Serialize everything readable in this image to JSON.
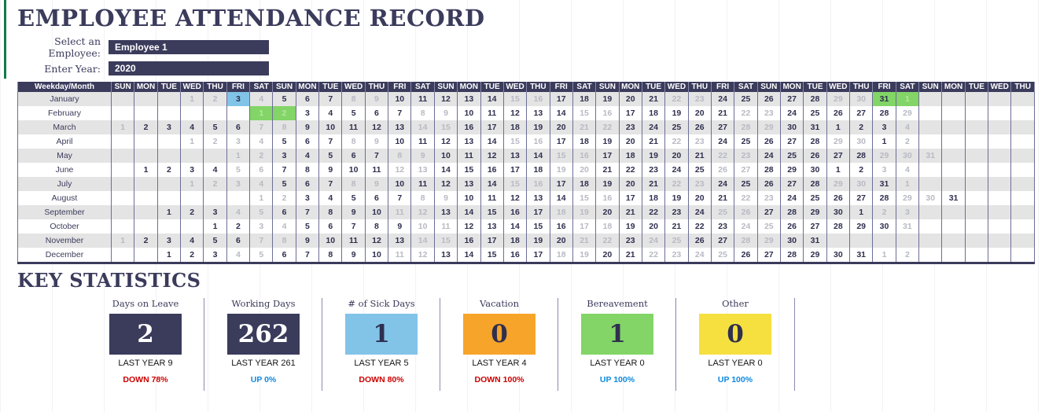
{
  "header": {
    "title": "EMPLOYEE ATTENDANCE RECORD",
    "employee_label": "Select an Employee:",
    "employee_value": "Employee 1",
    "year_label": "Enter Year:",
    "year_value": "2020"
  },
  "calendar": {
    "corner_header": "Weekday/Month",
    "weekday_cycle": [
      "SUN",
      "MON",
      "TUE",
      "WED",
      "THU",
      "FRI",
      "SAT"
    ],
    "column_count": 40,
    "columns": [
      "SUN",
      "MON",
      "TUE",
      "WED",
      "THU",
      "FRI",
      "SAT",
      "SUN",
      "MON",
      "TUE",
      "WED",
      "THU",
      "FRI",
      "SAT",
      "SUN",
      "MON",
      "TUE",
      "WED",
      "THU",
      "FRI",
      "SAT",
      "SUN",
      "MON",
      "TUE",
      "WED",
      "THU",
      "FRI",
      "SAT",
      "SUN",
      "MON",
      "TUE",
      "WED",
      "THU",
      "FRI",
      "SAT",
      "SUN",
      "MON",
      "TUE",
      "WED",
      "THU"
    ],
    "rows": [
      {
        "month": "January",
        "cells": [
          "",
          "",
          "",
          1,
          2,
          3,
          4,
          5,
          6,
          7,
          8,
          9,
          10,
          11,
          12,
          13,
          14,
          15,
          16,
          17,
          18,
          19,
          20,
          21,
          22,
          23,
          24,
          25,
          26,
          27,
          28,
          29,
          30,
          31,
          1,
          "",
          "",
          "",
          "",
          ""
        ],
        "weekend_idx": [
          3,
          4,
          5,
          6,
          10,
          11,
          17,
          18,
          24,
          25,
          31,
          32,
          34
        ],
        "sick_idx": [
          5
        ],
        "leave_idx": [
          33,
          34
        ]
      },
      {
        "month": "February",
        "cells": [
          "",
          "",
          "",
          "",
          "",
          "",
          1,
          2,
          3,
          4,
          5,
          6,
          7,
          8,
          9,
          10,
          11,
          12,
          13,
          14,
          15,
          16,
          17,
          18,
          19,
          20,
          21,
          22,
          23,
          24,
          25,
          26,
          27,
          28,
          29,
          "",
          "",
          "",
          "",
          ""
        ],
        "weekend_idx": [
          6,
          7,
          13,
          14,
          20,
          21,
          27,
          28,
          34
        ],
        "sick_idx": [],
        "leave_idx": [
          6,
          7
        ]
      },
      {
        "month": "March",
        "cells": [
          1,
          2,
          3,
          4,
          5,
          6,
          7,
          8,
          9,
          10,
          11,
          12,
          13,
          14,
          15,
          16,
          17,
          18,
          19,
          20,
          21,
          22,
          23,
          24,
          25,
          26,
          27,
          28,
          29,
          30,
          31,
          1,
          2,
          3,
          4,
          "",
          "",
          "",
          "",
          ""
        ],
        "weekend_idx": [
          0,
          6,
          7,
          13,
          14,
          20,
          21,
          27,
          28,
          34
        ],
        "sick_idx": [],
        "leave_idx": []
      },
      {
        "month": "April",
        "cells": [
          "",
          "",
          "",
          1,
          2,
          3,
          4,
          5,
          6,
          7,
          8,
          9,
          10,
          11,
          12,
          13,
          14,
          15,
          16,
          17,
          18,
          19,
          20,
          21,
          22,
          23,
          24,
          25,
          26,
          27,
          28,
          29,
          30,
          1,
          2,
          "",
          "",
          "",
          "",
          ""
        ],
        "weekend_idx": [
          3,
          4,
          5,
          6,
          10,
          11,
          17,
          18,
          24,
          25,
          31,
          32,
          34
        ],
        "sick_idx": [],
        "leave_idx": []
      },
      {
        "month": "May",
        "cells": [
          "",
          "",
          "",
          "",
          "",
          1,
          2,
          3,
          4,
          5,
          6,
          7,
          8,
          9,
          10,
          11,
          12,
          13,
          14,
          15,
          16,
          17,
          18,
          19,
          20,
          21,
          22,
          23,
          24,
          25,
          26,
          27,
          28,
          29,
          30,
          31,
          "",
          "",
          "",
          ""
        ],
        "weekend_idx": [
          5,
          6,
          12,
          13,
          19,
          20,
          26,
          27,
          33,
          34,
          35
        ],
        "sick_idx": [],
        "leave_idx": []
      },
      {
        "month": "June",
        "cells": [
          "",
          1,
          2,
          3,
          4,
          5,
          6,
          7,
          8,
          9,
          10,
          11,
          12,
          13,
          14,
          15,
          16,
          17,
          18,
          19,
          20,
          21,
          22,
          23,
          24,
          25,
          26,
          27,
          28,
          29,
          30,
          1,
          2,
          3,
          4,
          "",
          "",
          "",
          "",
          ""
        ],
        "weekend_idx": [
          5,
          6,
          12,
          13,
          19,
          20,
          26,
          27,
          33,
          34
        ],
        "sick_idx": [],
        "leave_idx": []
      },
      {
        "month": "July",
        "cells": [
          "",
          "",
          "",
          1,
          2,
          3,
          4,
          5,
          6,
          7,
          8,
          9,
          10,
          11,
          12,
          13,
          14,
          15,
          16,
          17,
          18,
          19,
          20,
          21,
          22,
          23,
          24,
          25,
          26,
          27,
          28,
          29,
          30,
          31,
          1,
          "",
          "",
          "",
          "",
          ""
        ],
        "weekend_idx": [
          3,
          4,
          5,
          6,
          10,
          11,
          17,
          18,
          24,
          25,
          31,
          32,
          34
        ],
        "sick_idx": [],
        "leave_idx": []
      },
      {
        "month": "August",
        "cells": [
          "",
          "",
          "",
          "",
          "",
          "",
          1,
          2,
          3,
          4,
          5,
          6,
          7,
          8,
          9,
          10,
          11,
          12,
          13,
          14,
          15,
          16,
          17,
          18,
          19,
          20,
          21,
          22,
          23,
          24,
          25,
          26,
          27,
          28,
          29,
          30,
          31,
          "",
          "",
          ""
        ],
        "weekend_idx": [
          6,
          7,
          13,
          14,
          20,
          21,
          27,
          28,
          34,
          35
        ],
        "sick_idx": [],
        "leave_idx": []
      },
      {
        "month": "September",
        "cells": [
          "",
          "",
          1,
          2,
          3,
          4,
          5,
          6,
          7,
          8,
          9,
          10,
          11,
          12,
          13,
          14,
          15,
          16,
          17,
          18,
          19,
          20,
          21,
          22,
          23,
          24,
          25,
          26,
          27,
          28,
          29,
          30,
          1,
          2,
          3,
          "",
          "",
          "",
          "",
          ""
        ],
        "weekend_idx": [
          5,
          6,
          12,
          13,
          19,
          20,
          26,
          27,
          33,
          34
        ],
        "sick_idx": [],
        "leave_idx": []
      },
      {
        "month": "October",
        "cells": [
          "",
          "",
          "",
          "",
          1,
          2,
          3,
          4,
          5,
          6,
          7,
          8,
          9,
          10,
          11,
          12,
          13,
          14,
          15,
          16,
          17,
          18,
          19,
          20,
          21,
          22,
          23,
          24,
          25,
          26,
          27,
          28,
          29,
          30,
          31,
          "",
          "",
          "",
          "",
          ""
        ],
        "weekend_idx": [
          6,
          7,
          13,
          14,
          20,
          21,
          27,
          28,
          34
        ],
        "sick_idx": [],
        "leave_idx": []
      },
      {
        "month": "November",
        "cells": [
          1,
          2,
          3,
          4,
          5,
          6,
          7,
          8,
          9,
          10,
          11,
          12,
          13,
          14,
          15,
          16,
          17,
          18,
          19,
          20,
          21,
          22,
          23,
          24,
          25,
          26,
          27,
          28,
          29,
          30,
          31,
          "",
          "",
          "",
          "",
          "",
          "",
          "",
          "",
          ""
        ],
        "weekend_idx": [
          0,
          6,
          7,
          13,
          14,
          20,
          21,
          23,
          24,
          27,
          28,
          34
        ],
        "sick_idx": [],
        "leave_idx": []
      },
      {
        "month": "December",
        "cells": [
          "",
          "",
          1,
          2,
          3,
          4,
          5,
          6,
          7,
          8,
          9,
          10,
          11,
          12,
          13,
          14,
          15,
          16,
          17,
          18,
          19,
          20,
          21,
          22,
          23,
          24,
          25,
          26,
          27,
          28,
          29,
          30,
          31,
          1,
          2,
          "",
          "",
          "",
          "",
          ""
        ],
        "weekend_idx": [
          5,
          6,
          12,
          13,
          19,
          20,
          23,
          24,
          25,
          26,
          33,
          34
        ],
        "sick_idx": [],
        "leave_idx": []
      }
    ]
  },
  "statistics": {
    "title": "KEY STATISTICS",
    "last_year_prefix": "LAST YEAR",
    "cards": [
      {
        "label": "Days on Leave",
        "value": "2",
        "last_year": "LAST YEAR  9",
        "delta": "DOWN 78%",
        "delta_dir": "down",
        "box_color": "#3b3b5c",
        "value_color": "#ffffff"
      },
      {
        "label": "Working Days",
        "value": "262",
        "last_year": "LAST YEAR  261",
        "delta": "UP 0%",
        "delta_dir": "up",
        "box_color": "#3b3b5c",
        "value_color": "#ffffff"
      },
      {
        "label": "# of Sick Days",
        "value": "1",
        "last_year": "LAST YEAR  5",
        "delta": "DOWN 80%",
        "delta_dir": "down",
        "box_color": "#82c3e8",
        "value_color": "#2f2f4f"
      },
      {
        "label": "Vacation",
        "value": "0",
        "last_year": "LAST YEAR  4",
        "delta": "DOWN 100%",
        "delta_dir": "down",
        "box_color": "#f7a42b",
        "value_color": "#2f2f4f"
      },
      {
        "label": "Bereavement",
        "value": "1",
        "last_year": "LAST YEAR  0",
        "delta": "UP 100%",
        "delta_dir": "up",
        "box_color": "#82d566",
        "value_color": "#2f2f4f"
      },
      {
        "label": "Other",
        "value": "0",
        "last_year": "LAST YEAR  0",
        "delta": "UP 100%",
        "delta_dir": "up",
        "box_color": "#f5e040",
        "value_color": "#2f2f4f"
      }
    ]
  },
  "colors": {
    "navy": "#3b3b5c",
    "sick_blue": "#82c3e8",
    "leave_green": "#82d566",
    "vacation_orange": "#f7a42b",
    "other_yellow": "#f5e040",
    "down_red": "#cc0000",
    "up_blue": "#0d8ae0",
    "row_stripe": "#e4e4e4",
    "accent_rail_green": "#0f7a4a"
  }
}
